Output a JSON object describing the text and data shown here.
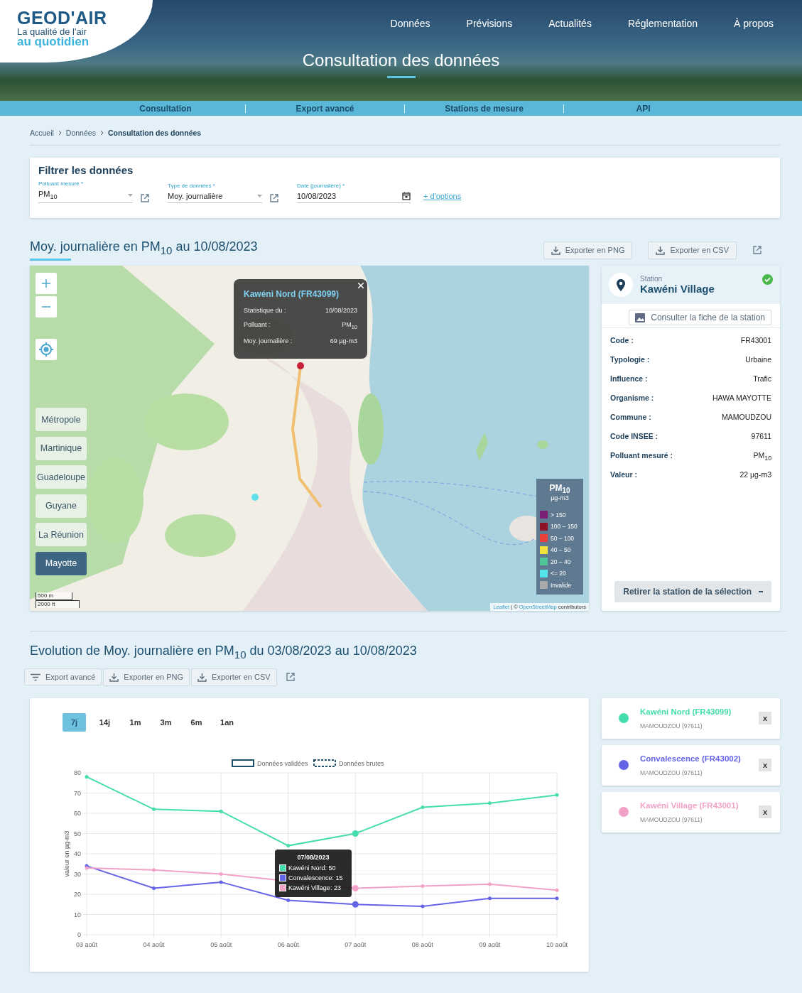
{
  "header": {
    "logo": {
      "title": "GEOD'AIR",
      "tagline": "La qualité de l'air",
      "tagline2": "au quotidien"
    },
    "nav": [
      {
        "label": "Données"
      },
      {
        "label": "Prévisions"
      },
      {
        "label": "Actualités"
      },
      {
        "label": "Réglementation"
      },
      {
        "label": "À propos"
      }
    ],
    "page_title": "Consultation des données"
  },
  "subnav": [
    {
      "label": "Consultation"
    },
    {
      "label": "Export avancé"
    },
    {
      "label": "Stations de mesure"
    },
    {
      "label": "API"
    }
  ],
  "breadcrumb": [
    {
      "label": "Accueil"
    },
    {
      "label": "Données"
    },
    {
      "label": "Consultation des données"
    }
  ],
  "filter": {
    "title": "Filtrer les données",
    "fields": [
      {
        "kind": "select",
        "label": "Polluant mesuré *",
        "value": "PM$_{10}$"
      },
      {
        "kind": "select",
        "label": "Type de données *",
        "value": "Moy. journalière"
      },
      {
        "kind": "date",
        "label": "Date (journalière) *",
        "value": "10/08/2023"
      }
    ],
    "more_link": "+ d'options"
  },
  "map_section": {
    "title": "Moy. journalière en PM$_{10}$ au 10/08/2023",
    "buttons": [
      {
        "label": "Exporter en PNG"
      },
      {
        "label": "Exporter en CSV"
      }
    ],
    "map": {
      "territories": [
        {
          "label": "Métropole",
          "selected": false
        },
        {
          "label": "Martinique",
          "selected": false
        },
        {
          "label": "Guadeloupe",
          "selected": false
        },
        {
          "label": "Guyane",
          "selected": false
        },
        {
          "label": "La Réunion",
          "selected": false
        },
        {
          "label": "Mayotte",
          "selected": true
        }
      ],
      "popup": {
        "title": "Kawéni Nord (FR43099)",
        "rows": [
          {
            "label": "Statistique du :",
            "value": "10/08/2023"
          },
          {
            "label": "Polluant :",
            "value": "PM$_{10}$"
          },
          {
            "label": "Moy. journalière :",
            "value": "69 µg-m3"
          }
        ]
      },
      "legend": {
        "title": "PM$_{10}$",
        "unit": "µg-m3",
        "items": [
          {
            "label": "> 150",
            "color": "#7b1f74"
          },
          {
            "label": "100 – 150",
            "color": "#8c1228"
          },
          {
            "label": "50 – 100",
            "color": "#e8403a"
          },
          {
            "label": "40 – 50",
            "color": "#f2e23c"
          },
          {
            "label": "20 – 40",
            "color": "#4fc597"
          },
          {
            "label": "<= 20",
            "color": "#55e3ea"
          },
          {
            "label": "Invalide",
            "color": "#a9a9a9"
          }
        ]
      },
      "scale": [
        "500 m",
        "2000 ft"
      ],
      "attribution": {
        "link1": "Leaflet",
        "separator": "| ©",
        "link2": "OpenStreetMap",
        "text": "contributors"
      }
    },
    "station": {
      "caption": "Station",
      "name": "Kawéni Village",
      "sheet_button": "Consulter la fiche de la station",
      "details": [
        {
          "label": "Code :",
          "value": "FR43001"
        },
        {
          "label": "Typologie :",
          "value": "Urbaine"
        },
        {
          "label": "Influence :",
          "value": "Trafic"
        },
        {
          "label": "Organisme :",
          "value": "HAWA MAYOTTE"
        },
        {
          "label": "Commune :",
          "value": "MAMOUDZOU"
        },
        {
          "label": "Code INSEE :",
          "value": "97611"
        },
        {
          "label": "Polluant mesuré :",
          "value": "PM$_{10}$"
        },
        {
          "label": "Valeur :",
          "value": "22 µg-m3"
        }
      ],
      "remove_button": "Retirer la station de la sélection"
    }
  },
  "evolution": {
    "title": "Evolution de Moy. journalière en PM$_{10}$ du 03/08/2023 au 10/08/2023",
    "buttons": [
      {
        "kind": "filter",
        "label": "Export avancé"
      },
      {
        "kind": "download",
        "label": "Exporter en PNG"
      },
      {
        "kind": "download",
        "label": "Exporter en CSV"
      }
    ],
    "ranges": [
      {
        "label": "7j",
        "selected": true
      },
      {
        "label": "14j",
        "selected": false
      },
      {
        "label": "1m",
        "selected": false
      },
      {
        "label": "3m",
        "selected": false
      },
      {
        "label": "6m",
        "selected": false
      },
      {
        "label": "1an",
        "selected": false
      }
    ],
    "legend": [
      {
        "kind": "solid",
        "label": "Données validées"
      },
      {
        "kind": "dashed",
        "label": "Données brutes"
      }
    ],
    "chart_data": {
      "type": "line",
      "grid": true,
      "legend": true,
      "ylabel": "valeur en µg-m3",
      "categories": [
        "03 août",
        "04 août",
        "05 août",
        "06 août",
        "07 août",
        "08 août",
        "09 août",
        "10 août"
      ],
      "ylim": [
        0,
        80
      ],
      "yticks": [
        0,
        10,
        20,
        30,
        40,
        50,
        60,
        70,
        80
      ],
      "series": [
        {
          "name": "Kawéni Nord",
          "color": "#45dcae",
          "values": [
            78,
            62,
            61,
            44,
            50,
            63,
            65,
            69
          ]
        },
        {
          "name": "Convalescence",
          "color": "#6464e6",
          "values": [
            34,
            23,
            26,
            17,
            15,
            14,
            18,
            18
          ]
        },
        {
          "name": "Kawéni Village",
          "color": "#f2a1c7",
          "values": [
            33,
            32,
            30,
            null,
            23,
            24,
            25,
            22
          ]
        }
      ]
    },
    "tooltip": {
      "title": "07/08/2023",
      "rows": [
        {
          "separator": ":",
          "value": "50"
        },
        {
          "separator": ":",
          "value": "15"
        },
        {
          "separator": ":",
          "value": "23"
        }
      ]
    },
    "stations": [
      {
        "name": "Kawéni Nord (FR43099)",
        "place": "MAMOUDZOU (97611)",
        "color": "#45dcae",
        "remove": "x"
      },
      {
        "name": "Convalescence (FR43002)",
        "place": "MAMOUDZOU (97611)",
        "color": "#6464e6",
        "remove": "x"
      },
      {
        "name": "Kawéni Village (FR43001)",
        "place": "MAMOUDZOU (97611)",
        "color": "#f2a1c7",
        "remove": "x"
      }
    ]
  }
}
